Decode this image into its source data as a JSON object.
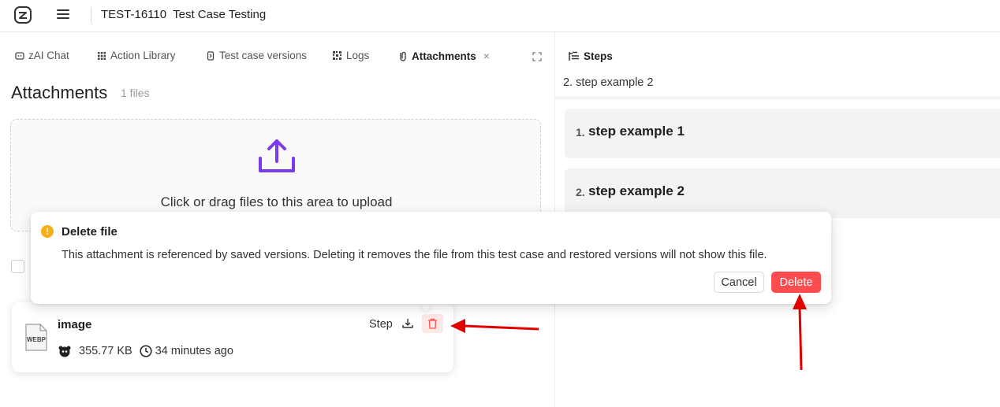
{
  "header": {
    "ticket_key": "TEST-16110",
    "ticket_title": "Test Case Testing"
  },
  "tabs": [
    {
      "label": "zAI Chat",
      "icon": "chat-icon"
    },
    {
      "label": "Action Library",
      "icon": "grid-icon"
    },
    {
      "label": "Test case versions",
      "icon": "versions-icon"
    },
    {
      "label": "Logs",
      "icon": "logs-icon"
    },
    {
      "label": "Attachments",
      "icon": "attachment-icon",
      "active": true,
      "close": "×"
    }
  ],
  "attachments": {
    "title": "Attachments",
    "count": "1 files",
    "dropzone_text": "Click or drag files to this area to upload"
  },
  "file": {
    "name": "image",
    "type_label": "WEBP",
    "size": "355.77 KB",
    "time": "34 minutes ago",
    "step_label": "Step"
  },
  "steps": {
    "header": "Steps",
    "current": "2. step example 2",
    "items": [
      {
        "num": "1.",
        "text": "step example 1"
      },
      {
        "num": "2.",
        "text": "step example 2"
      }
    ]
  },
  "popconfirm": {
    "title": "Delete file",
    "message": "This attachment is referenced by saved versions. Deleting it removes the file from this test case and restored versions will not show this file.",
    "cancel_label": "Cancel",
    "delete_label": "Delete",
    "warn_glyph": "!"
  },
  "colors": {
    "accent": "#7c3aed",
    "danger": "#ff4d4f",
    "warning": "#faad14",
    "annotation": "#e00000"
  }
}
